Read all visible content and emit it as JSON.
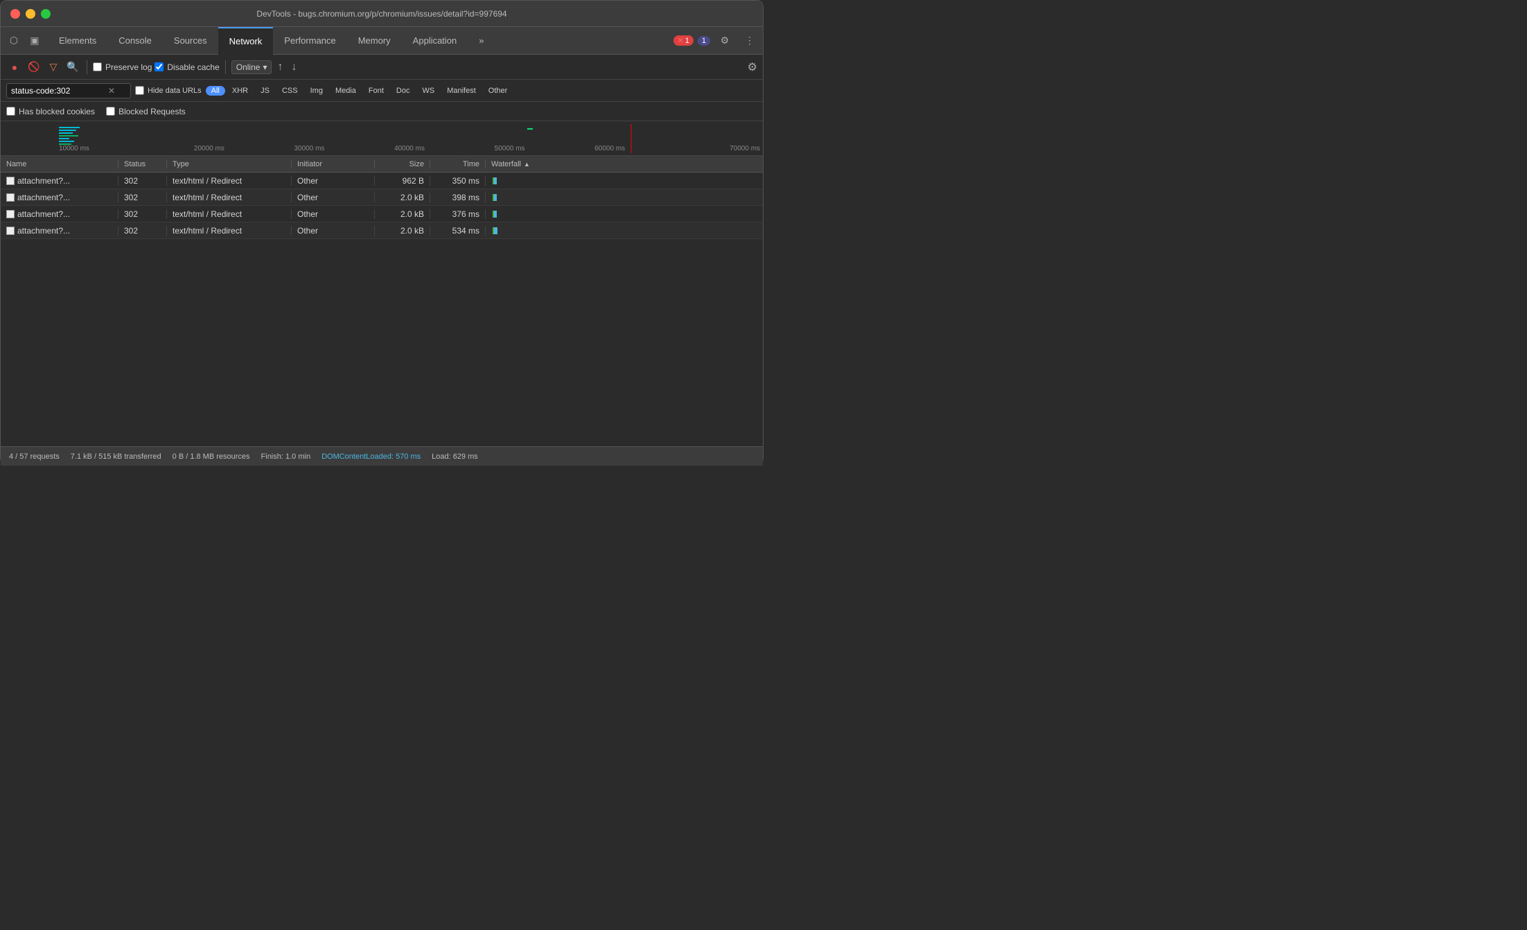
{
  "titleBar": {
    "title": "DevTools - bugs.chromium.org/p/chromium/issues/detail?id=997694"
  },
  "tabs": {
    "items": [
      {
        "label": "Elements",
        "active": false
      },
      {
        "label": "Console",
        "active": false
      },
      {
        "label": "Sources",
        "active": false
      },
      {
        "label": "Network",
        "active": true
      },
      {
        "label": "Performance",
        "active": false
      },
      {
        "label": "Memory",
        "active": false
      },
      {
        "label": "Application",
        "active": false
      }
    ],
    "more_label": "»",
    "error_count": "1",
    "warning_count": "1"
  },
  "toolbar": {
    "preserve_log_label": "Preserve log",
    "disable_cache_label": "Disable cache",
    "online_label": "Online"
  },
  "filter": {
    "value": "status-code:302",
    "hide_data_urls_label": "Hide data URLs",
    "types": [
      "All",
      "XHR",
      "JS",
      "CSS",
      "Img",
      "Media",
      "Font",
      "Doc",
      "WS",
      "Manifest",
      "Other"
    ],
    "active_type": "All"
  },
  "checkboxes": {
    "has_blocked_cookies": "Has blocked cookies",
    "blocked_requests": "Blocked Requests"
  },
  "timeline": {
    "labels": [
      "10000 ms",
      "20000 ms",
      "30000 ms",
      "40000 ms",
      "50000 ms",
      "60000 ms",
      "70000 ms"
    ]
  },
  "tableHeader": {
    "name": "Name",
    "status": "Status",
    "type": "Type",
    "initiator": "Initiator",
    "size": "Size",
    "time": "Time",
    "waterfall": "Waterfall"
  },
  "tableRows": [
    {
      "name": "attachment?...",
      "status": "302",
      "type": "text/html / Redirect",
      "initiator": "Other",
      "size": "962 B",
      "time": "350 ms",
      "barOffset": 2,
      "barWidth": 4
    },
    {
      "name": "attachment?...",
      "status": "302",
      "type": "text/html / Redirect",
      "initiator": "Other",
      "size": "2.0 kB",
      "time": "398 ms",
      "barOffset": 2,
      "barWidth": 4
    },
    {
      "name": "attachment?...",
      "status": "302",
      "type": "text/html / Redirect",
      "initiator": "Other",
      "size": "2.0 kB",
      "time": "376 ms",
      "barOffset": 2,
      "barWidth": 4
    },
    {
      "name": "attachment?...",
      "status": "302",
      "type": "text/html / Redirect",
      "initiator": "Other",
      "size": "2.0 kB",
      "time": "534 ms",
      "barOffset": 2,
      "barWidth": 5
    }
  ],
  "statusBar": {
    "requests": "4 / 57 requests",
    "transferred": "7.1 kB / 515 kB transferred",
    "resources": "0 B / 1.8 MB resources",
    "finish": "Finish: 1.0 min",
    "dom_content_loaded": "DOMContentLoaded: 570 ms",
    "load": "Load: 629 ms"
  }
}
